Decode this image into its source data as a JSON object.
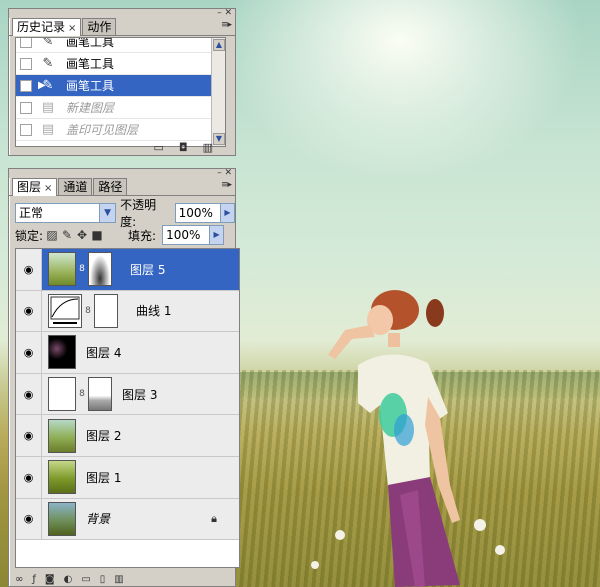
{
  "history_panel": {
    "tabs": [
      {
        "label": "历史记录",
        "close": "×"
      },
      {
        "label": "动作"
      }
    ],
    "items": [
      {
        "label": "画笔工具",
        "icon": "brush-icon",
        "state": "normal"
      },
      {
        "label": "画笔工具",
        "icon": "brush-icon",
        "state": "normal"
      },
      {
        "label": "画笔工具",
        "icon": "brush-icon",
        "state": "selected"
      },
      {
        "label": "新建图层",
        "icon": "document-icon",
        "state": "dimmed"
      },
      {
        "label": "盖印可见图层",
        "icon": "document-icon",
        "state": "dimmed"
      }
    ]
  },
  "layers_panel": {
    "tabs": [
      {
        "label": "图层",
        "close": "×"
      },
      {
        "label": "通道"
      },
      {
        "label": "路径"
      }
    ],
    "blend_mode": "正常",
    "opacity_label": "不透明度:",
    "opacity_value": "100%",
    "lock_label": "锁定:",
    "fill_label": "填充:",
    "fill_value": "100%",
    "layers": [
      {
        "name": "图层 5",
        "selected": true,
        "has_mask": true
      },
      {
        "name": "曲线 1",
        "selected": false,
        "has_mask": true,
        "adjustment": "curves"
      },
      {
        "name": "图层 4",
        "selected": false,
        "has_mask": false
      },
      {
        "name": "图层 3",
        "selected": false,
        "has_mask": true
      },
      {
        "name": "图层 2",
        "selected": false,
        "has_mask": false
      },
      {
        "name": "图层 1",
        "selected": false,
        "has_mask": false
      },
      {
        "name": "背景",
        "selected": false,
        "has_mask": false,
        "locked": true
      }
    ]
  },
  "colors": {
    "selection": "#3465c2",
    "panel_bg": "#d4d0c8"
  }
}
